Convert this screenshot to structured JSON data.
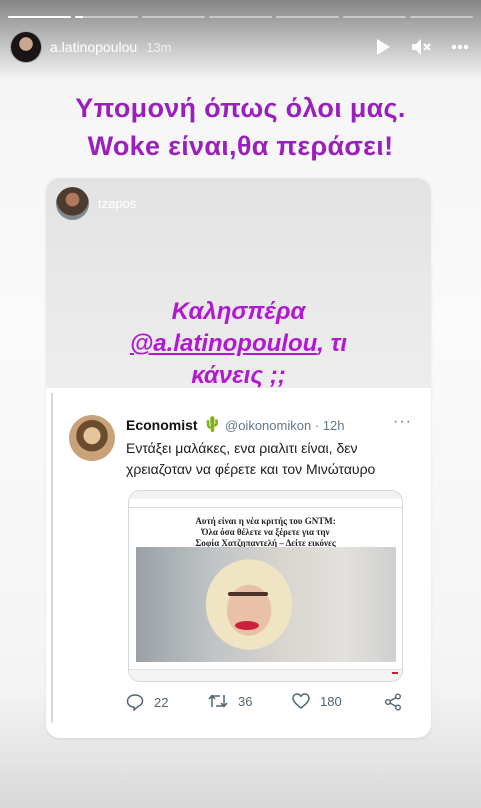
{
  "story": {
    "username": "a.latinopoulou",
    "time_ago": "13m",
    "progress_segments": 7,
    "active_segment_progress": 1.0,
    "current_segment": 2,
    "icons": [
      "play-icon",
      "mute-icon",
      "more-icon"
    ]
  },
  "caption": {
    "line1": "Υπομονή όπως όλοι μας.",
    "line2": "Woke είναι,θα περάσει!",
    "color": "#9b1fbd"
  },
  "reshared_story": {
    "username": "tzapos",
    "greeting_line1": "Καλησπέρα",
    "greeting_mention": "@a.latinopoulou",
    "greeting_line2_rest": ", τι",
    "greeting_line3": "κάνεις ;;",
    "greeting_color": "#b317d4"
  },
  "tweet": {
    "name": "Economist",
    "name_emoji": "🌵",
    "handle": "@oikonomikon",
    "time": "· 12h",
    "text": "Εντάξει μαλάκες, ενα ριαλιτι είναι, δεν χρειαζοταν να φέρετε και τον Μινώταυρο",
    "replies": "22",
    "retweets": "36",
    "likes": "180",
    "icons": [
      "reply-icon",
      "retweet-icon",
      "like-icon",
      "share-icon"
    ]
  },
  "article_image": {
    "title_line1": "Αυτή είναι η νέα κριτής του GNTM:",
    "title_line2": "Όλα όσα θέλετε να ξέρετε για την",
    "title_line3": "Σοφία Χατζηπαντελή – Δείτε εικόνες"
  }
}
